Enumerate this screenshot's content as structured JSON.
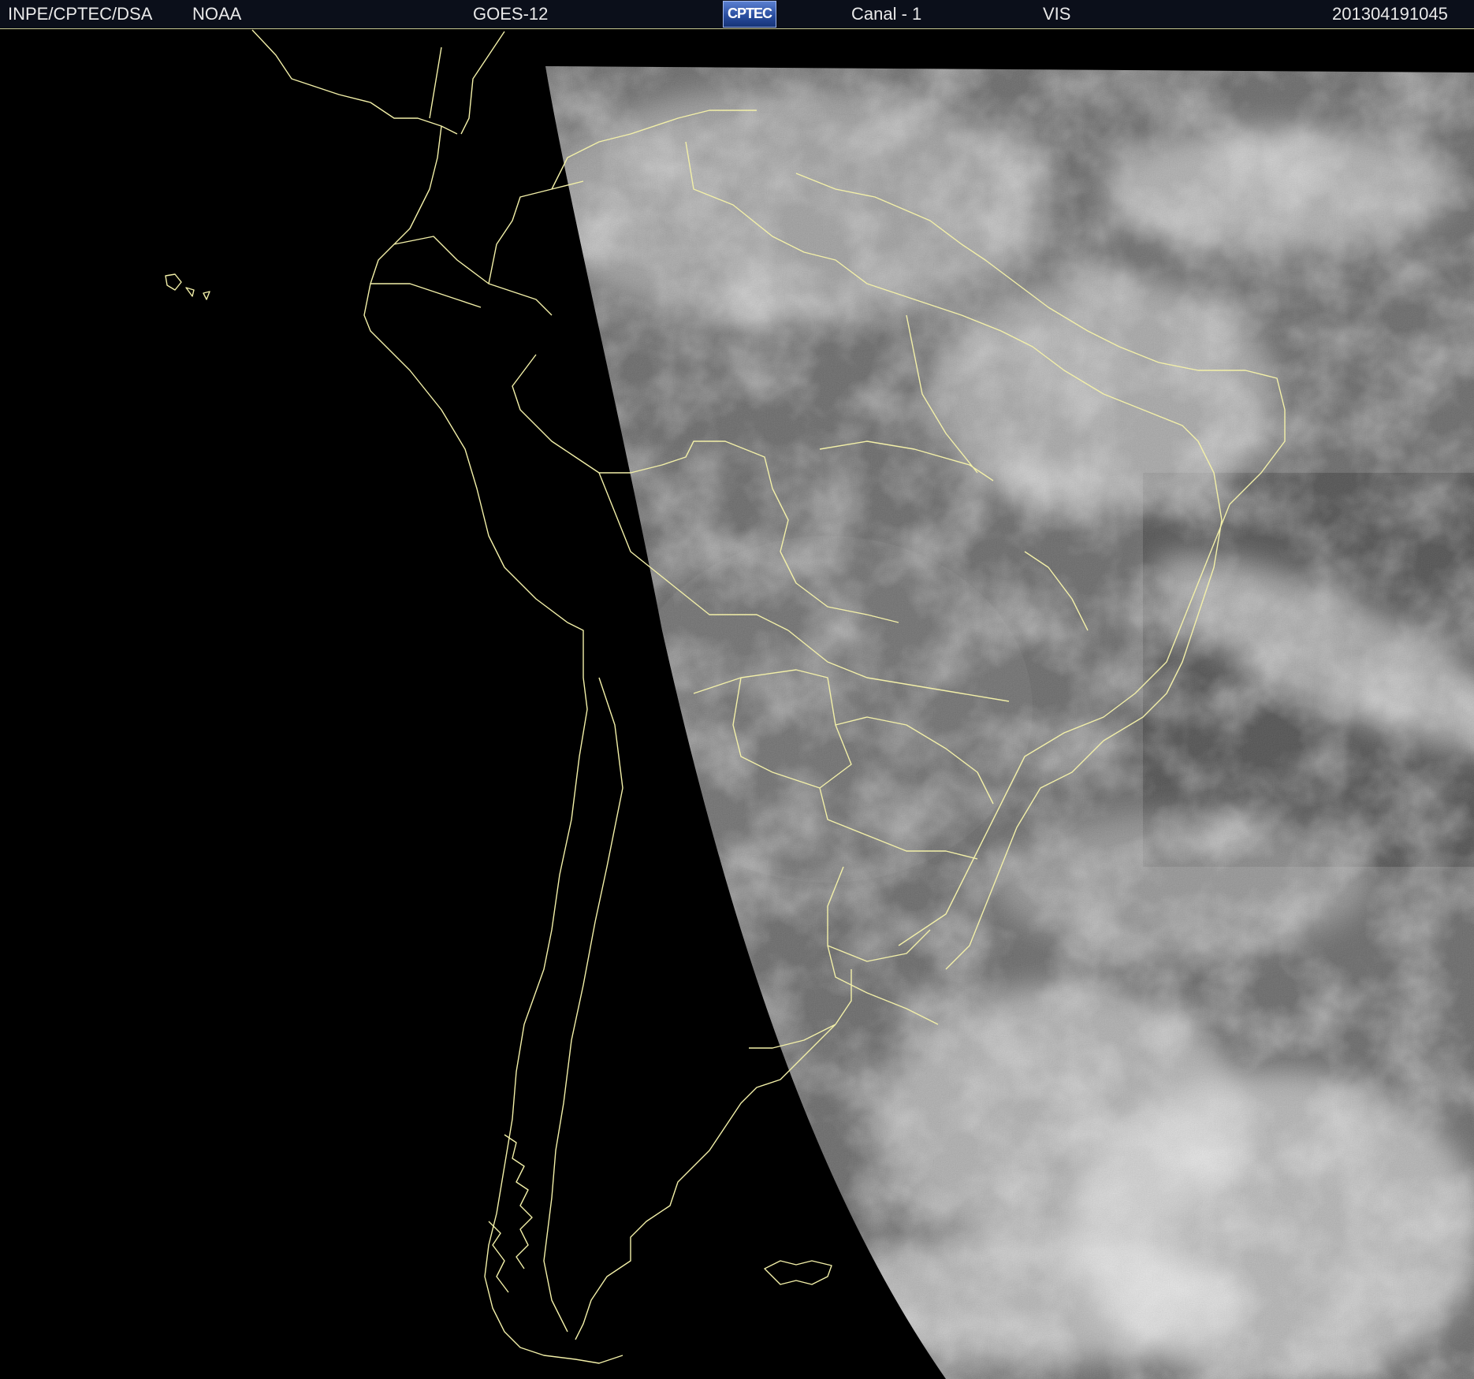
{
  "header": {
    "source": "INPE/CPTEC/DSA",
    "agency": "NOAA",
    "satellite": "GOES-12",
    "logo_text": "CPTEC",
    "channel": "Canal - 1",
    "band": "VIS",
    "timestamp": "201304191045"
  },
  "colors": {
    "background": "#000000",
    "header_bg": "#0b0f1a",
    "header_text": "#e9e9e9",
    "coastline": "#f3f0a8",
    "imagery": "#8a8a8a"
  },
  "map": {
    "projection": "satellite visible imagery",
    "region": "South America"
  }
}
